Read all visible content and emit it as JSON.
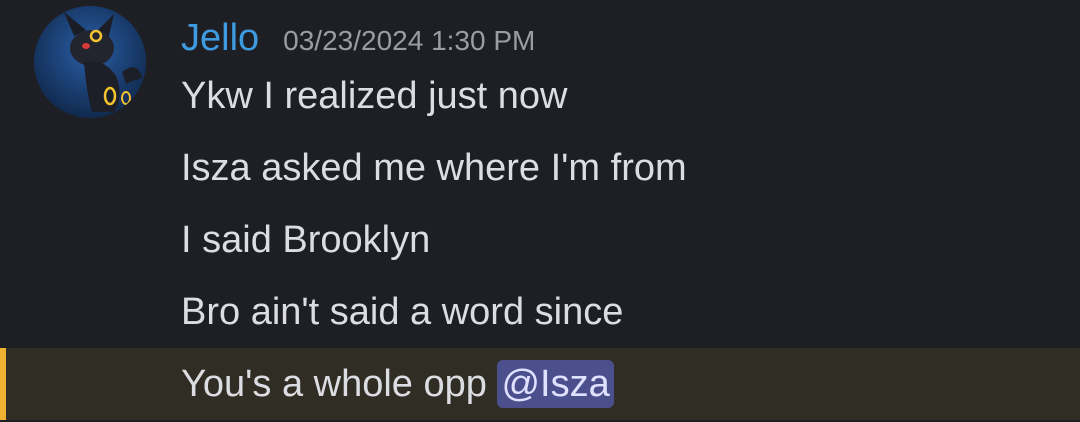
{
  "message": {
    "username": "Jello",
    "timestamp": "03/23/2024 1:30 PM",
    "lines": [
      "Ykw I realized just now",
      "Isza asked me where I'm from",
      "I said Brooklyn",
      "Bro ain't said a word since"
    ],
    "last_line_prefix": "You's a whole opp ",
    "mention": "@Isza"
  },
  "colors": {
    "background": "#1e1f24",
    "username": "#3e9be0",
    "mention_bar": "#f0b232",
    "mention_highlight": "#302d24",
    "mention_pill": "#4b4f8c"
  },
  "icons": {
    "avatar": "umbreon-avatar-icon"
  }
}
